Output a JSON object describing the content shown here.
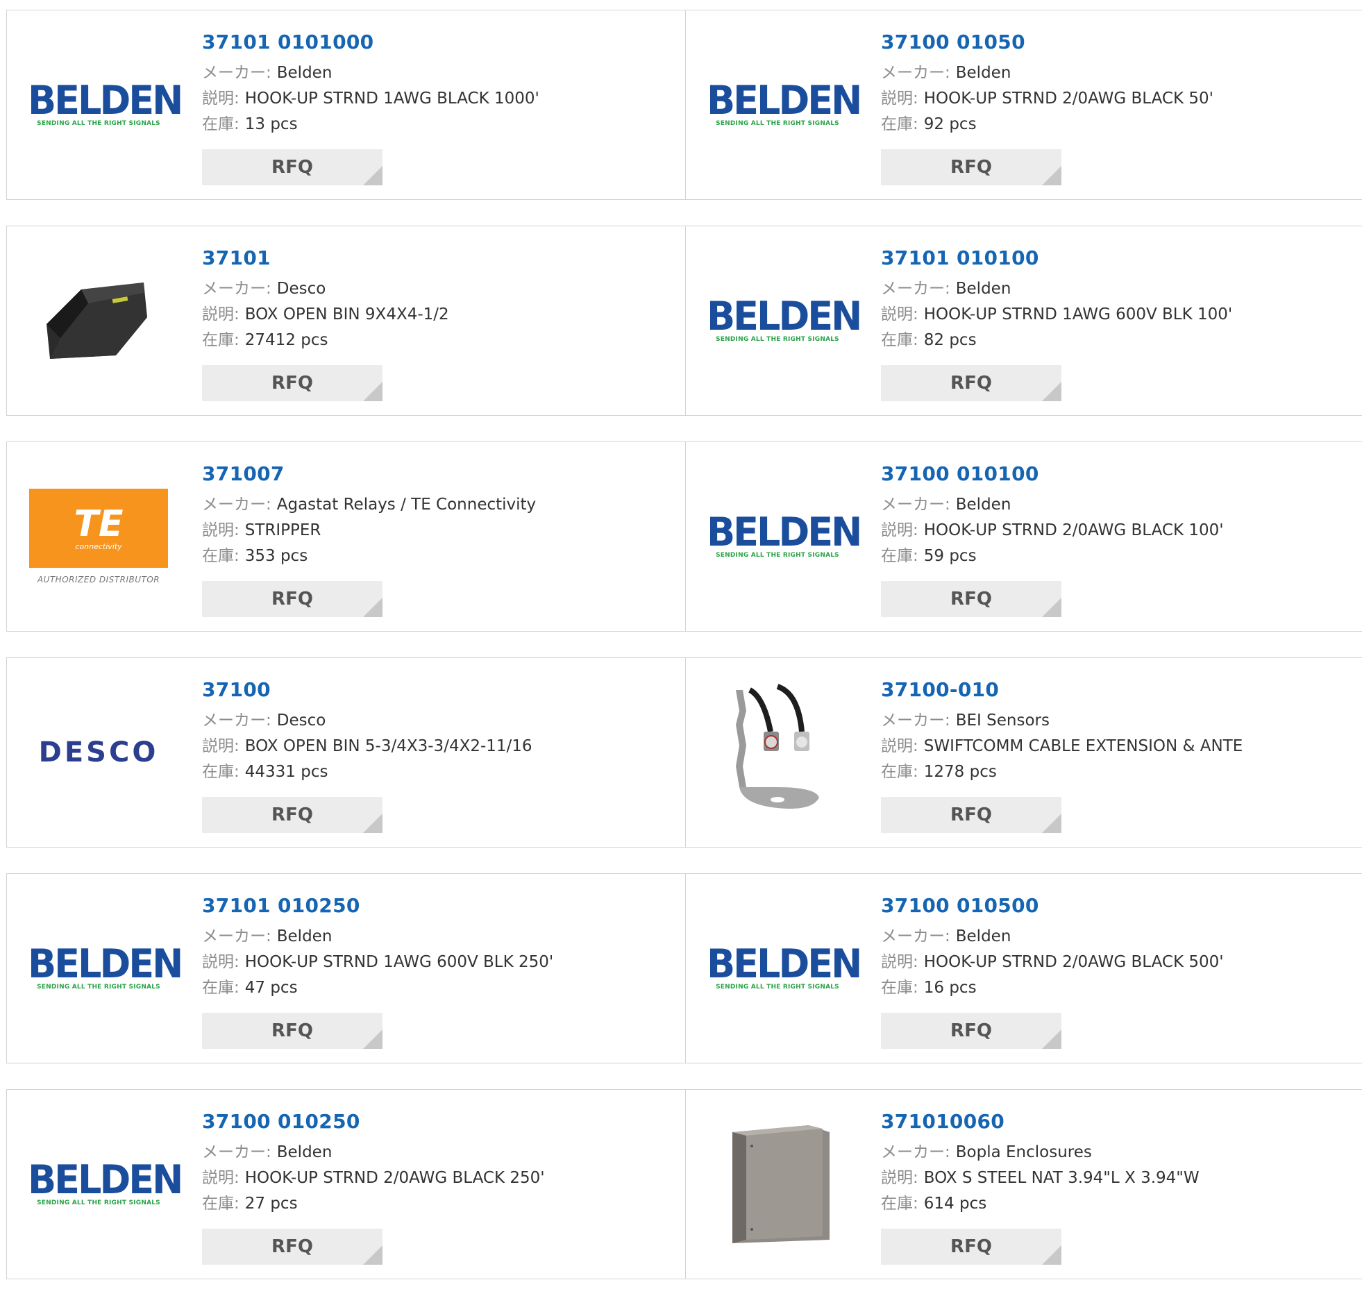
{
  "labels": {
    "manufacturer": "メーカー:",
    "description": "説明:",
    "stock": "在庫:",
    "rfq": "RFQ"
  },
  "products": [
    {
      "part": "37101 0101000",
      "manufacturer": "Belden",
      "description": "HOOK-UP STRND 1AWG BLACK 1000'",
      "stock": "13 pcs",
      "image": "belden-logo"
    },
    {
      "part": "37100 01050",
      "manufacturer": "Belden",
      "description": "HOOK-UP STRND 2/0AWG BLACK 50'",
      "stock": "92 pcs",
      "image": "belden-logo"
    },
    {
      "part": "37101",
      "manufacturer": "Desco",
      "description": "BOX OPEN BIN 9X4X4-1/2",
      "stock": "27412 pcs",
      "image": "black-bin-photo"
    },
    {
      "part": "37101 010100",
      "manufacturer": "Belden",
      "description": "HOOK-UP STRND 1AWG 600V BLK 100'",
      "stock": "82 pcs",
      "image": "belden-logo"
    },
    {
      "part": "371007",
      "manufacturer": "Agastat Relays / TE Connectivity",
      "description": "STRIPPER",
      "stock": "353 pcs",
      "image": "te-logo"
    },
    {
      "part": "37100 010100",
      "manufacturer": "Belden",
      "description": "HOOK-UP STRND 2/0AWG BLACK 100'",
      "stock": "59 pcs",
      "image": "belden-logo"
    },
    {
      "part": "37100",
      "manufacturer": "Desco",
      "description": "BOX OPEN BIN 5-3/4X3-3/4X2-11/16",
      "stock": "44331 pcs",
      "image": "desco-logo"
    },
    {
      "part": "37100-010",
      "manufacturer": "BEI Sensors",
      "description": "SWIFTCOMM CABLE EXTENSION & ANTE",
      "stock": "1278 pcs",
      "image": "antenna-cable-photo"
    },
    {
      "part": "37101 010250",
      "manufacturer": "Belden",
      "description": "HOOK-UP STRND 1AWG 600V BLK 250'",
      "stock": "47 pcs",
      "image": "belden-logo"
    },
    {
      "part": "37100 010500",
      "manufacturer": "Belden",
      "description": "HOOK-UP STRND 2/0AWG BLACK 500'",
      "stock": "16 pcs",
      "image": "belden-logo"
    },
    {
      "part": "37100 010250",
      "manufacturer": "Belden",
      "description": "HOOK-UP STRND 2/0AWG BLACK 250'",
      "stock": "27 pcs",
      "image": "belden-logo"
    },
    {
      "part": "371010060",
      "manufacturer": "Bopla Enclosures",
      "description": "BOX S STEEL NAT 3.94\"L X 3.94\"W",
      "stock": "614 pcs",
      "image": "steel-enclosure-photo"
    }
  ],
  "logos": {
    "belden_word": "BELDEN",
    "belden_tagline": "SENDING ALL THE RIGHT SIGNALS",
    "desco_word": "DESCO",
    "te_word": "TE",
    "te_sub": "connectivity",
    "te_authorized": "AUTHORIZED DISTRIBUTOR"
  },
  "colors": {
    "part_link": "#1565b3",
    "label_gray": "#8c8c8c",
    "rfq_bg": "#ececec",
    "card_border": "#d3d3d3",
    "belden_blue": "#1a4d9c",
    "belden_green": "#2aa34a",
    "te_orange": "#f7941d",
    "desco_blue": "#2b3e8f"
  }
}
